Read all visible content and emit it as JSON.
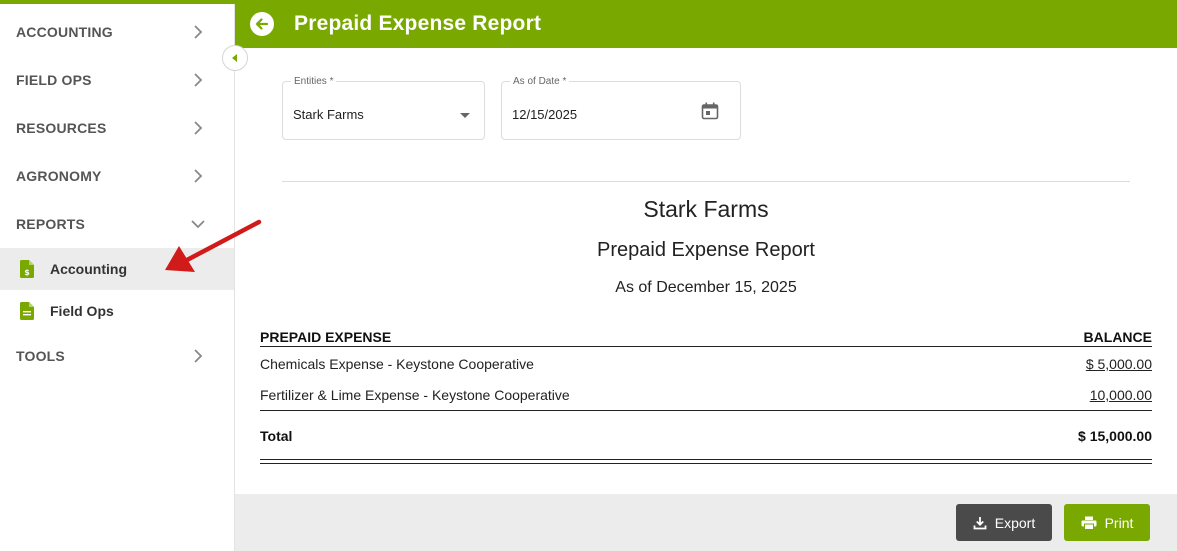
{
  "sidebar": {
    "items": [
      {
        "label": "ACCOUNTING",
        "icon": "chevron-right-icon"
      },
      {
        "label": "FIELD OPS",
        "icon": "chevron-right-icon"
      },
      {
        "label": "RESOURCES",
        "icon": "chevron-right-icon"
      },
      {
        "label": "AGRONOMY",
        "icon": "chevron-right-icon"
      },
      {
        "label": "REPORTS",
        "icon": "chevron-down-icon"
      },
      {
        "label": "TOOLS",
        "icon": "chevron-right-icon"
      }
    ],
    "reports_sub": [
      {
        "label": "Accounting",
        "icon": "dollar-document-icon",
        "active": true
      },
      {
        "label": "Field Ops",
        "icon": "document-icon",
        "active": false
      }
    ]
  },
  "header": {
    "title": "Prepaid Expense Report",
    "back_icon": "arrow-left-circle-icon"
  },
  "filters": {
    "entities_label": "Entities *",
    "entities_value": "Stark Farms",
    "date_label": "As of Date *",
    "date_value": "12/15/2025",
    "date_icon": "calendar-icon"
  },
  "report": {
    "company": "Stark Farms",
    "title": "Prepaid Expense Report",
    "as_of": "As of December 15, 2025",
    "col_expense": "PREPAID EXPENSE",
    "col_balance": "BALANCE",
    "rows": [
      {
        "name": "Chemicals Expense - Keystone Cooperative",
        "balance": "$ 5,000.00"
      },
      {
        "name": "Fertilizer & Lime Expense - Keystone Cooperative",
        "balance": "10,000.00"
      }
    ],
    "total_label": "Total",
    "total_value": "$ 15,000.00"
  },
  "footer": {
    "export_label": "Export",
    "print_label": "Print"
  },
  "colors": {
    "accent": "#79a800",
    "dark_button": "#4a4a4a",
    "annotation_arrow": "#d11a1a"
  }
}
